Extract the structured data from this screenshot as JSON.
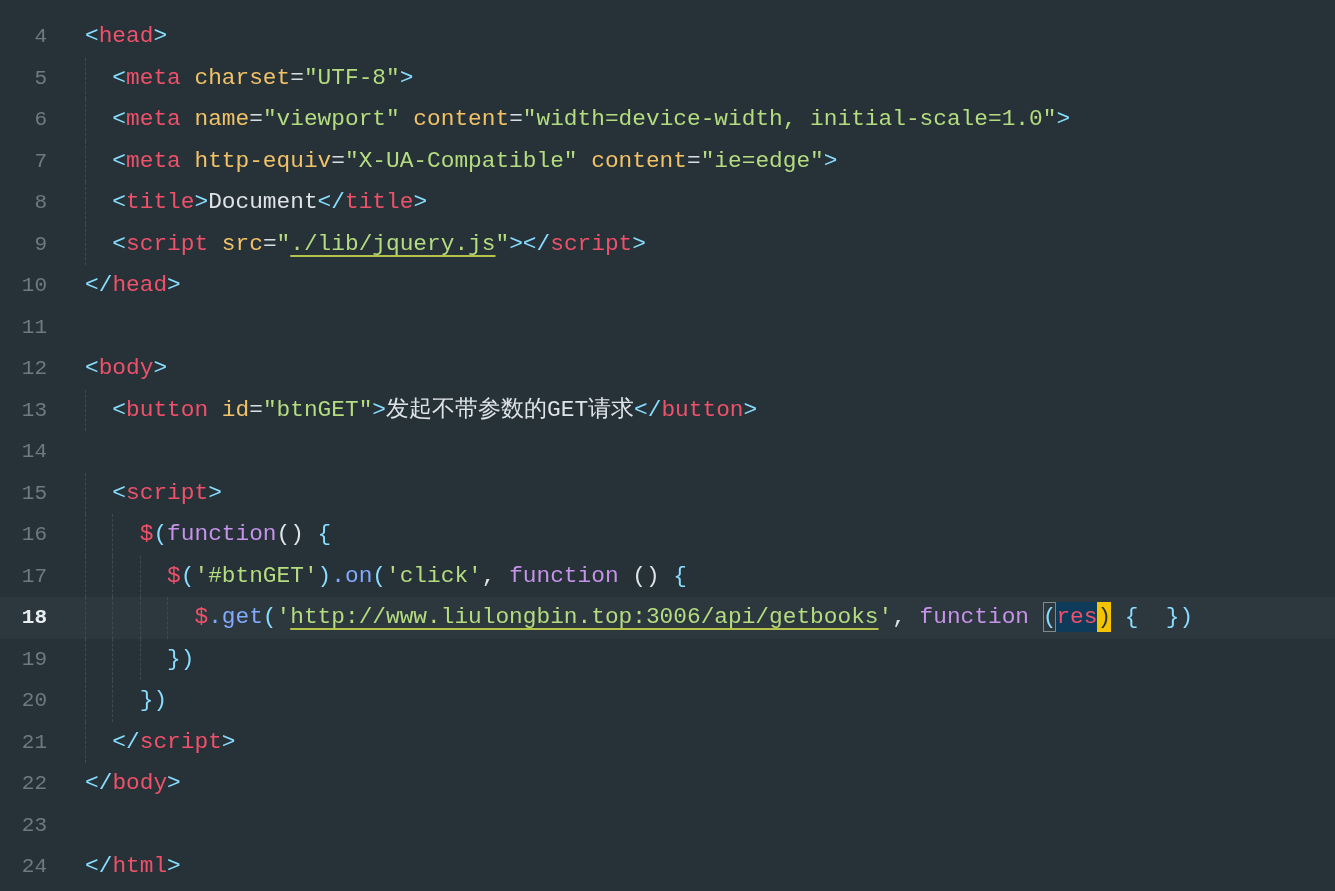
{
  "editor": {
    "lines": [
      {
        "number": "4",
        "selected": false,
        "tokens": [
          {
            "t": "<",
            "kind": "p"
          },
          {
            "t": "head",
            "kind": "tag"
          },
          {
            "t": ">",
            "kind": "p"
          }
        ]
      },
      {
        "number": "5",
        "selected": false,
        "tokens": [
          {
            "t": "  <",
            "kind": "p"
          },
          {
            "t": "meta",
            "kind": "tag"
          },
          {
            "t": " charset",
            "kind": "attr"
          },
          {
            "t": "=",
            "kind": "eq"
          },
          {
            "t": "\"UTF-8\"",
            "kind": "str"
          },
          {
            "t": ">",
            "kind": "p"
          }
        ]
      },
      {
        "number": "6",
        "selected": false,
        "tokens": [
          {
            "t": "  <",
            "kind": "p"
          },
          {
            "t": "meta",
            "kind": "tag"
          },
          {
            "t": " name",
            "kind": "attr"
          },
          {
            "t": "=",
            "kind": "eq"
          },
          {
            "t": "\"viewport\"",
            "kind": "str"
          },
          {
            "t": " content",
            "kind": "attr"
          },
          {
            "t": "=",
            "kind": "eq"
          },
          {
            "t": "\"width=device-width, initial-scale=1.0\"",
            "kind": "str"
          },
          {
            "t": ">",
            "kind": "p"
          }
        ]
      },
      {
        "number": "7",
        "selected": false,
        "tokens": [
          {
            "t": "  <",
            "kind": "p"
          },
          {
            "t": "meta",
            "kind": "tag"
          },
          {
            "t": " http-equiv",
            "kind": "attr"
          },
          {
            "t": "=",
            "kind": "eq"
          },
          {
            "t": "\"X-UA-Compatible\"",
            "kind": "str"
          },
          {
            "t": " content",
            "kind": "attr"
          },
          {
            "t": "=",
            "kind": "eq"
          },
          {
            "t": "\"ie=edge\"",
            "kind": "str"
          },
          {
            "t": ">",
            "kind": "p"
          }
        ]
      },
      {
        "number": "8",
        "selected": false,
        "tokens": [
          {
            "t": "  <",
            "kind": "p"
          },
          {
            "t": "title",
            "kind": "tag"
          },
          {
            "t": ">",
            "kind": "p"
          },
          {
            "t": "Document",
            "kind": "text"
          },
          {
            "t": "</",
            "kind": "p"
          },
          {
            "t": "title",
            "kind": "tag"
          },
          {
            "t": ">",
            "kind": "p"
          }
        ]
      },
      {
        "number": "9",
        "selected": false,
        "tokens": [
          {
            "t": "  <",
            "kind": "p"
          },
          {
            "t": "script",
            "kind": "tag"
          },
          {
            "t": " src",
            "kind": "attr"
          },
          {
            "t": "=",
            "kind": "eq"
          },
          {
            "t": "\"",
            "kind": "str"
          },
          {
            "t": "./lib/jquery.js",
            "kind": "link"
          },
          {
            "t": "\"",
            "kind": "str"
          },
          {
            "t": "></",
            "kind": "p"
          },
          {
            "t": "script",
            "kind": "tag"
          },
          {
            "t": ">",
            "kind": "p"
          }
        ]
      },
      {
        "number": "10",
        "selected": false,
        "tokens": [
          {
            "t": "</",
            "kind": "p"
          },
          {
            "t": "head",
            "kind": "tag"
          },
          {
            "t": ">",
            "kind": "p"
          }
        ]
      },
      {
        "number": "11",
        "selected": false
      },
      {
        "number": "12",
        "selected": false,
        "tokens": [
          {
            "t": "<",
            "kind": "p"
          },
          {
            "t": "body",
            "kind": "tag"
          },
          {
            "t": ">",
            "kind": "p"
          }
        ]
      },
      {
        "number": "13",
        "selected": false,
        "tokens": [
          {
            "t": "  <",
            "kind": "p"
          },
          {
            "t": "button",
            "kind": "tag"
          },
          {
            "t": " id",
            "kind": "attr"
          },
          {
            "t": "=",
            "kind": "eq"
          },
          {
            "t": "\"btnGET\"",
            "kind": "str"
          },
          {
            "t": ">",
            "kind": "p"
          },
          {
            "t": "发起不带参数的GET请求",
            "kind": "text"
          },
          {
            "t": "</",
            "kind": "p"
          },
          {
            "t": "button",
            "kind": "tag"
          },
          {
            "t": ">",
            "kind": "p"
          }
        ]
      },
      {
        "number": "14",
        "selected": false
      },
      {
        "number": "15",
        "selected": false,
        "tokens": [
          {
            "t": "  <",
            "kind": "p"
          },
          {
            "t": "script",
            "kind": "tag"
          },
          {
            "t": ">",
            "kind": "p"
          }
        ]
      },
      {
        "number": "16",
        "selected": false,
        "tokens": [
          {
            "t": "    $",
            "kind": "dollar"
          },
          {
            "t": "(",
            "kind": "p"
          },
          {
            "t": "function",
            "kind": "kw"
          },
          {
            "t": "()",
            "kind": "text"
          },
          {
            "t": " {",
            "kind": "p"
          }
        ]
      },
      {
        "number": "17",
        "selected": false,
        "tokens": [
          {
            "t": "      $",
            "kind": "dollar"
          },
          {
            "t": "(",
            "kind": "p"
          },
          {
            "t": "'#btnGET'",
            "kind": "str"
          },
          {
            "t": ")",
            "kind": "p"
          },
          {
            "t": ".on",
            "kind": "method"
          },
          {
            "t": "(",
            "kind": "p"
          },
          {
            "t": "'click'",
            "kind": "str"
          },
          {
            "t": ", ",
            "kind": "text"
          },
          {
            "t": "function",
            "kind": "kw"
          },
          {
            "t": " () ",
            "kind": "text"
          },
          {
            "t": "{",
            "kind": "p"
          }
        ]
      },
      {
        "number": "18",
        "selected": true,
        "tokens": [
          {
            "t": "        $",
            "kind": "dollar"
          },
          {
            "t": ".get",
            "kind": "method"
          },
          {
            "t": "(",
            "kind": "p"
          },
          {
            "t": "'",
            "kind": "str"
          },
          {
            "t": "http://www.liulongbin.top:3006/api/getbooks",
            "kind": "link"
          },
          {
            "t": "'",
            "kind": "str"
          },
          {
            "t": ", ",
            "kind": "text"
          },
          {
            "t": "function ",
            "kind": "kw"
          },
          {
            "t": "(",
            "kind": "bm"
          },
          {
            "t": "res",
            "kind": "sel"
          },
          {
            "t": ")",
            "kind": "cur"
          },
          {
            "t": " {  })",
            "kind": "p"
          }
        ]
      },
      {
        "number": "19",
        "selected": false,
        "tokens": [
          {
            "t": "      })",
            "kind": "p"
          }
        ]
      },
      {
        "number": "20",
        "selected": false,
        "tokens": [
          {
            "t": "    })",
            "kind": "p"
          }
        ]
      },
      {
        "number": "21",
        "selected": false,
        "tokens": [
          {
            "t": "  </",
            "kind": "p"
          },
          {
            "t": "script",
            "kind": "tag"
          },
          {
            "t": ">",
            "kind": "p"
          }
        ]
      },
      {
        "number": "22",
        "selected": false,
        "tokens": [
          {
            "t": "</",
            "kind": "p"
          },
          {
            "t": "body",
            "kind": "tag"
          },
          {
            "t": ">",
            "kind": "p"
          }
        ]
      },
      {
        "number": "23",
        "selected": false
      },
      {
        "number": "24",
        "selected": false,
        "tokens": [
          {
            "t": "</",
            "kind": "p"
          },
          {
            "t": "html",
            "kind": "tag"
          },
          {
            "t": ">",
            "kind": "p"
          }
        ]
      }
    ]
  }
}
